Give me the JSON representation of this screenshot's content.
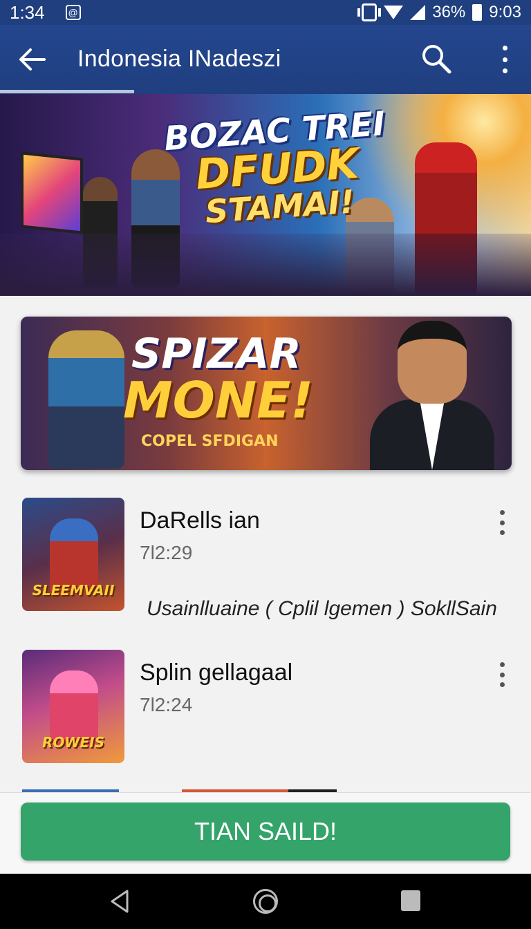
{
  "status_bar": {
    "time": "1:34",
    "battery": "36%",
    "clock_right": "9:03"
  },
  "app_bar": {
    "title": "Indonesia INadeszi"
  },
  "hero_banner": {
    "line1": "BOZAC TREI",
    "line2": "DFUDK",
    "line3": "STAMAI!"
  },
  "promo_banner": {
    "line1": "SPIZAR",
    "line2": "MONE!",
    "subtitle": "COPEL SFDIGAN"
  },
  "list": [
    {
      "title": "DaRells ian",
      "time": "7l2:29",
      "thumb_label": "SLEEMVAII",
      "meta": "Usainlluaine ( Cplil lgemen ) SokllSain"
    },
    {
      "title": "Splin gellagaal",
      "time": "7l2:24",
      "thumb_label": "ROWEIS"
    }
  ],
  "cta": {
    "label": "TIAN SAILD!"
  },
  "colors": {
    "app_bar": "#24468e",
    "cta": "#35a46b"
  },
  "icons": [
    "back-arrow-icon",
    "search-icon",
    "more-vert-icon",
    "nav-back-icon",
    "nav-home-icon",
    "nav-recents-icon"
  ]
}
